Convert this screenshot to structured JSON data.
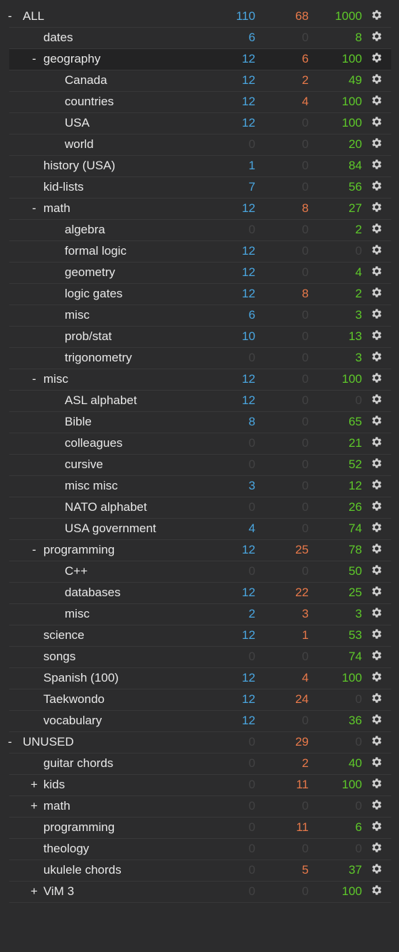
{
  "colors": {
    "background": "#2c2c2d",
    "due": "#4aa6e0",
    "learning": "#e8794a",
    "new": "#5ec92a",
    "zero": "#424243",
    "text": "#e8e8e8"
  },
  "icons": {
    "options": "gear-icon"
  },
  "decks": [
    {
      "name": "ALL",
      "level": 0,
      "expander": "-",
      "due": "110",
      "learn": "68",
      "new": "1000"
    },
    {
      "name": "dates",
      "level": 1,
      "expander": "",
      "due": "6",
      "learn": "0",
      "new": "8"
    },
    {
      "name": "geography",
      "level": 1,
      "expander": "-",
      "due": "12",
      "learn": "6",
      "new": "100",
      "selected": true
    },
    {
      "name": "Canada",
      "level": 2,
      "expander": "",
      "due": "12",
      "learn": "2",
      "new": "49"
    },
    {
      "name": "countries",
      "level": 2,
      "expander": "",
      "due": "12",
      "learn": "4",
      "new": "100"
    },
    {
      "name": "USA",
      "level": 2,
      "expander": "",
      "due": "12",
      "learn": "0",
      "new": "100"
    },
    {
      "name": "world",
      "level": 2,
      "expander": "",
      "due": "0",
      "learn": "0",
      "new": "20"
    },
    {
      "name": "history (USA)",
      "level": 1,
      "expander": "",
      "due": "1",
      "learn": "0",
      "new": "84"
    },
    {
      "name": "kid-lists",
      "level": 1,
      "expander": "",
      "due": "7",
      "learn": "0",
      "new": "56"
    },
    {
      "name": "math",
      "level": 1,
      "expander": "-",
      "due": "12",
      "learn": "8",
      "new": "27"
    },
    {
      "name": "algebra",
      "level": 2,
      "expander": "",
      "due": "0",
      "learn": "0",
      "new": "2"
    },
    {
      "name": "formal logic",
      "level": 2,
      "expander": "",
      "due": "12",
      "learn": "0",
      "new": "0"
    },
    {
      "name": "geometry",
      "level": 2,
      "expander": "",
      "due": "12",
      "learn": "0",
      "new": "4"
    },
    {
      "name": "logic gates",
      "level": 2,
      "expander": "",
      "due": "12",
      "learn": "8",
      "new": "2"
    },
    {
      "name": "misc",
      "level": 2,
      "expander": "",
      "due": "6",
      "learn": "0",
      "new": "3"
    },
    {
      "name": "prob/stat",
      "level": 2,
      "expander": "",
      "due": "10",
      "learn": "0",
      "new": "13"
    },
    {
      "name": "trigonometry",
      "level": 2,
      "expander": "",
      "due": "0",
      "learn": "0",
      "new": "3"
    },
    {
      "name": "misc",
      "level": 1,
      "expander": "-",
      "due": "12",
      "learn": "0",
      "new": "100"
    },
    {
      "name": "ASL alphabet",
      "level": 2,
      "expander": "",
      "due": "12",
      "learn": "0",
      "new": "0"
    },
    {
      "name": "Bible",
      "level": 2,
      "expander": "",
      "due": "8",
      "learn": "0",
      "new": "65"
    },
    {
      "name": "colleagues",
      "level": 2,
      "expander": "",
      "due": "0",
      "learn": "0",
      "new": "21"
    },
    {
      "name": "cursive",
      "level": 2,
      "expander": "",
      "due": "0",
      "learn": "0",
      "new": "52"
    },
    {
      "name": "misc misc",
      "level": 2,
      "expander": "",
      "due": "3",
      "learn": "0",
      "new": "12"
    },
    {
      "name": "NATO alphabet",
      "level": 2,
      "expander": "",
      "due": "0",
      "learn": "0",
      "new": "26"
    },
    {
      "name": "USA government",
      "level": 2,
      "expander": "",
      "due": "4",
      "learn": "0",
      "new": "74"
    },
    {
      "name": "programming",
      "level": 1,
      "expander": "-",
      "due": "12",
      "learn": "25",
      "new": "78"
    },
    {
      "name": "C++",
      "level": 2,
      "expander": "",
      "due": "0",
      "learn": "0",
      "new": "50"
    },
    {
      "name": "databases",
      "level": 2,
      "expander": "",
      "due": "12",
      "learn": "22",
      "new": "25"
    },
    {
      "name": "misc",
      "level": 2,
      "expander": "",
      "due": "2",
      "learn": "3",
      "new": "3"
    },
    {
      "name": "science",
      "level": 1,
      "expander": "",
      "due": "12",
      "learn": "1",
      "new": "53"
    },
    {
      "name": "songs",
      "level": 1,
      "expander": "",
      "due": "0",
      "learn": "0",
      "new": "74"
    },
    {
      "name": "Spanish (100)",
      "level": 1,
      "expander": "",
      "due": "12",
      "learn": "4",
      "new": "100"
    },
    {
      "name": "Taekwondo",
      "level": 1,
      "expander": "",
      "due": "12",
      "learn": "24",
      "new": "0"
    },
    {
      "name": "vocabulary",
      "level": 1,
      "expander": "",
      "due": "12",
      "learn": "0",
      "new": "36"
    },
    {
      "name": "UNUSED",
      "level": 0,
      "expander": "-",
      "due": "0",
      "learn": "29",
      "new": "0"
    },
    {
      "name": "guitar chords",
      "level": 1,
      "expander": "",
      "due": "0",
      "learn": "2",
      "new": "40"
    },
    {
      "name": "kids",
      "level": 1,
      "expander": "+",
      "due": "0",
      "learn": "11",
      "new": "100"
    },
    {
      "name": "math",
      "level": 1,
      "expander": "+",
      "due": "0",
      "learn": "0",
      "new": "0"
    },
    {
      "name": "programming",
      "level": 1,
      "expander": "",
      "due": "0",
      "learn": "11",
      "new": "6"
    },
    {
      "name": "theology",
      "level": 1,
      "expander": "",
      "due": "0",
      "learn": "0",
      "new": "0"
    },
    {
      "name": "ukulele chords",
      "level": 1,
      "expander": "",
      "due": "0",
      "learn": "5",
      "new": "37"
    },
    {
      "name": "ViM 3",
      "level": 1,
      "expander": "+",
      "due": "0",
      "learn": "0",
      "new": "100"
    }
  ]
}
